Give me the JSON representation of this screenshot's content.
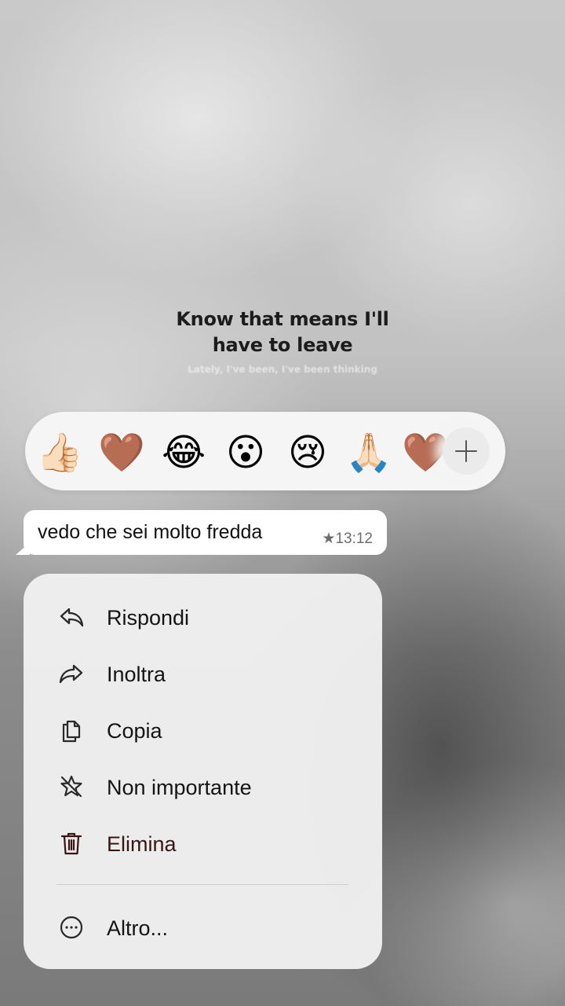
{
  "lyrics": {
    "main": "Know that means I'll have to leave",
    "sub": "Lately, I've been, I've been thinking"
  },
  "reactions": {
    "emojis": [
      "👍🏻",
      "🤎",
      "😂",
      "😮",
      "😢",
      "🙏🏻",
      "🤎"
    ],
    "more_icon": "plus-icon"
  },
  "message": {
    "text": "vedo che sei molto fredda",
    "starred_icon": "★",
    "time": "13:12"
  },
  "menu": {
    "items": [
      {
        "label": "Rispondi",
        "icon": "reply-icon"
      },
      {
        "label": "Inoltra",
        "icon": "forward-icon"
      },
      {
        "label": "Copia",
        "icon": "copy-icon"
      },
      {
        "label": "Non importante",
        "icon": "unstar-icon"
      },
      {
        "label": "Elimina",
        "icon": "trash-icon"
      },
      {
        "label": "Altro...",
        "icon": "more-icon"
      }
    ]
  },
  "colors": {
    "reaction_bar": "#f5f5f5",
    "bubble": "#ffffff",
    "menu": "#f0f0f0",
    "delete_label": "#3b1414"
  }
}
